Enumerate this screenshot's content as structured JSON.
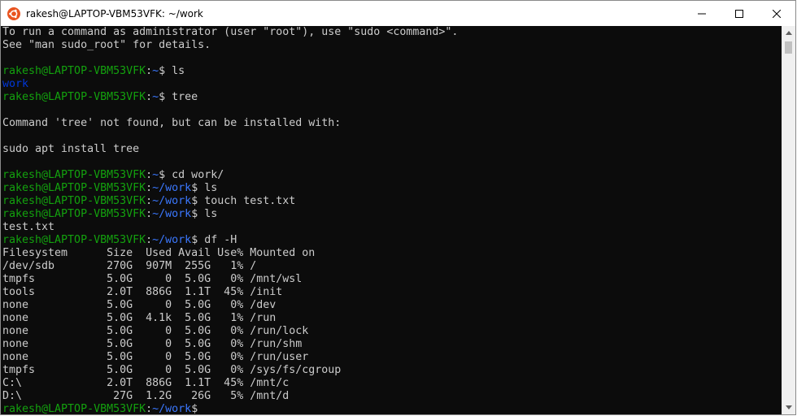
{
  "window": {
    "title": "rakesh@LAPTOP-VBM53VFK: ~/work",
    "controls": {
      "minimize": "minimize",
      "maximize": "maximize",
      "close": "close"
    }
  },
  "colors": {
    "prompt_user": "#13a10e",
    "prompt_path": "#3b78ff",
    "text": "#cccccc",
    "directory": "#0037da",
    "background": "#0c0c0c"
  },
  "terminal": {
    "lines": [
      [
        {
          "t": "To run a command as administrator (user \"root\"), use \"sudo <command>\".",
          "c": "default"
        }
      ],
      [
        {
          "t": "See \"man sudo_root\" for details.",
          "c": "default"
        }
      ],
      [
        {
          "t": "",
          "c": "default"
        }
      ],
      [
        {
          "t": "rakesh@LAPTOP-VBM53VFK",
          "c": "green"
        },
        {
          "t": ":",
          "c": "default"
        },
        {
          "t": "~",
          "c": "blue"
        },
        {
          "t": "$ ls",
          "c": "default"
        }
      ],
      [
        {
          "t": "work",
          "c": "dirblue"
        }
      ],
      [
        {
          "t": "rakesh@LAPTOP-VBM53VFK",
          "c": "green"
        },
        {
          "t": ":",
          "c": "default"
        },
        {
          "t": "~",
          "c": "blue"
        },
        {
          "t": "$ tree",
          "c": "default"
        }
      ],
      [
        {
          "t": "",
          "c": "default"
        }
      ],
      [
        {
          "t": "Command 'tree' not found, but can be installed with:",
          "c": "default"
        }
      ],
      [
        {
          "t": "",
          "c": "default"
        }
      ],
      [
        {
          "t": "sudo apt install tree",
          "c": "default"
        }
      ],
      [
        {
          "t": "",
          "c": "default"
        }
      ],
      [
        {
          "t": "rakesh@LAPTOP-VBM53VFK",
          "c": "green"
        },
        {
          "t": ":",
          "c": "default"
        },
        {
          "t": "~",
          "c": "blue"
        },
        {
          "t": "$ cd work/",
          "c": "default"
        }
      ],
      [
        {
          "t": "rakesh@LAPTOP-VBM53VFK",
          "c": "green"
        },
        {
          "t": ":",
          "c": "default"
        },
        {
          "t": "~/work",
          "c": "blue"
        },
        {
          "t": "$ ls",
          "c": "default"
        }
      ],
      [
        {
          "t": "rakesh@LAPTOP-VBM53VFK",
          "c": "green"
        },
        {
          "t": ":",
          "c": "default"
        },
        {
          "t": "~/work",
          "c": "blue"
        },
        {
          "t": "$ touch test.txt",
          "c": "default"
        }
      ],
      [
        {
          "t": "rakesh@LAPTOP-VBM53VFK",
          "c": "green"
        },
        {
          "t": ":",
          "c": "default"
        },
        {
          "t": "~/work",
          "c": "blue"
        },
        {
          "t": "$ ls",
          "c": "default"
        }
      ],
      [
        {
          "t": "test.txt",
          "c": "default"
        }
      ],
      [
        {
          "t": "rakesh@LAPTOP-VBM53VFK",
          "c": "green"
        },
        {
          "t": ":",
          "c": "default"
        },
        {
          "t": "~/work",
          "c": "blue"
        },
        {
          "t": "$ df -H",
          "c": "default"
        }
      ],
      [
        {
          "t": "Filesystem      Size  Used Avail Use% Mounted on",
          "c": "default"
        }
      ],
      [
        {
          "t": "/dev/sdb        270G  907M  255G   1% /",
          "c": "default"
        }
      ],
      [
        {
          "t": "tmpfs           5.0G     0  5.0G   0% /mnt/wsl",
          "c": "default"
        }
      ],
      [
        {
          "t": "tools           2.0T  886G  1.1T  45% /init",
          "c": "default"
        }
      ],
      [
        {
          "t": "none            5.0G     0  5.0G   0% /dev",
          "c": "default"
        }
      ],
      [
        {
          "t": "none            5.0G  4.1k  5.0G   1% /run",
          "c": "default"
        }
      ],
      [
        {
          "t": "none            5.0G     0  5.0G   0% /run/lock",
          "c": "default"
        }
      ],
      [
        {
          "t": "none            5.0G     0  5.0G   0% /run/shm",
          "c": "default"
        }
      ],
      [
        {
          "t": "none            5.0G     0  5.0G   0% /run/user",
          "c": "default"
        }
      ],
      [
        {
          "t": "tmpfs           5.0G     0  5.0G   0% /sys/fs/cgroup",
          "c": "default"
        }
      ],
      [
        {
          "t": "C:\\             2.0T  886G  1.1T  45% /mnt/c",
          "c": "default"
        }
      ],
      [
        {
          "t": "D:\\              27G  1.2G   26G   5% /mnt/d",
          "c": "default"
        }
      ],
      [
        {
          "t": "rakesh@LAPTOP-VBM53VFK",
          "c": "green"
        },
        {
          "t": ":",
          "c": "default"
        },
        {
          "t": "~/work",
          "c": "blue"
        },
        {
          "t": "$ ",
          "c": "default"
        }
      ]
    ]
  }
}
